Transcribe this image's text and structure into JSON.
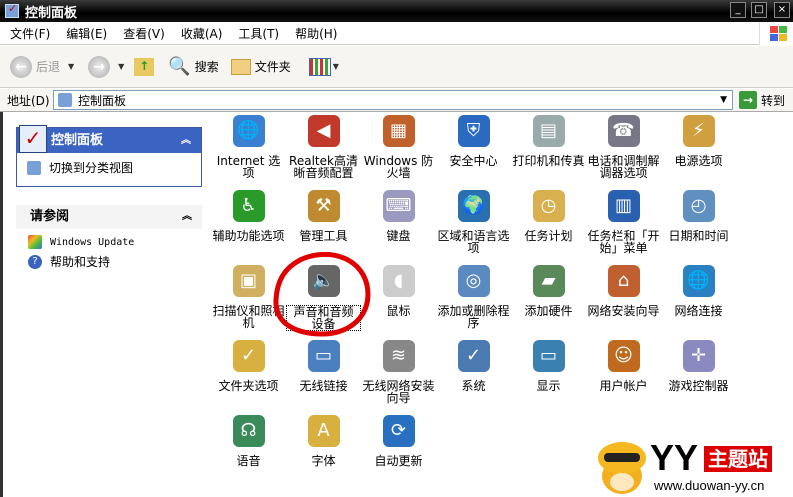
{
  "window": {
    "title": "控制面板",
    "min": "_",
    "max": "□",
    "close": "×"
  },
  "menu": [
    "文件(F)",
    "编辑(E)",
    "查看(V)",
    "收藏(A)",
    "工具(T)",
    "帮助(H)"
  ],
  "toolbar": {
    "back": "后退",
    "search": "搜索",
    "folders": "文件夹"
  },
  "address": {
    "label": "地址(D)",
    "value": "控制面板",
    "go": "转到"
  },
  "left": {
    "panel_title": "控制面板",
    "switch_view": "切换到分类视图",
    "see_also_title": "请参阅",
    "links": [
      "Windows Update",
      "帮助和支持"
    ]
  },
  "items": [
    {
      "label": "Internet 选项",
      "color": "#3a7fd0",
      "glyph": "🌐"
    },
    {
      "label": "Realtek高清晰音频配置",
      "color": "#c0392b",
      "glyph": "◀"
    },
    {
      "label": "Windows 防火墙",
      "color": "#c0602b",
      "glyph": "▦"
    },
    {
      "label": "安全中心",
      "color": "#2a6ac0",
      "glyph": "⛨"
    },
    {
      "label": "打印机和传真",
      "color": "#9aa",
      "glyph": "▤"
    },
    {
      "label": "电话和调制解调器选项",
      "color": "#778",
      "glyph": "☎"
    },
    {
      "label": "电源选项",
      "color": "#d0a040",
      "glyph": "⚡"
    },
    {
      "label": "辅助功能选项",
      "color": "#2a9a2a",
      "glyph": "♿"
    },
    {
      "label": "管理工具",
      "color": "#c08a30",
      "glyph": "⚒"
    },
    {
      "label": "键盘",
      "color": "#9a9ac0",
      "glyph": "⌨"
    },
    {
      "label": "区域和语言选项",
      "color": "#2a70b0",
      "glyph": "🌍"
    },
    {
      "label": "任务计划",
      "color": "#d8b050",
      "glyph": "◷"
    },
    {
      "label": "任务栏和「开始」菜单",
      "color": "#2a60b0",
      "glyph": "▥"
    },
    {
      "label": "日期和时间",
      "color": "#6090c0",
      "glyph": "◴"
    },
    {
      "label": "扫描仪和照相机",
      "color": "#d0b060",
      "glyph": "▣"
    },
    {
      "label": "声音和音频设备",
      "color": "#666",
      "glyph": "🔈",
      "selected": true
    },
    {
      "label": "鼠标",
      "color": "#ccc",
      "glyph": "◖"
    },
    {
      "label": "添加或删除程序",
      "color": "#5a8ac0",
      "glyph": "◎"
    },
    {
      "label": "添加硬件",
      "color": "#5a8a5a",
      "glyph": "▰"
    },
    {
      "label": "网络安装向导",
      "color": "#c06030",
      "glyph": "⌂"
    },
    {
      "label": "网络连接",
      "color": "#2a80c0",
      "glyph": "🌐"
    },
    {
      "label": "文件夹选项",
      "color": "#d8b040",
      "glyph": "✓"
    },
    {
      "label": "无线链接",
      "color": "#4a80c0",
      "glyph": "▭"
    },
    {
      "label": "无线网络安装向导",
      "color": "#888",
      "glyph": "≋"
    },
    {
      "label": "系统",
      "color": "#4a7ab0",
      "glyph": "✓"
    },
    {
      "label": "显示",
      "color": "#3a80b0",
      "glyph": "▭"
    },
    {
      "label": "用户帐户",
      "color": "#c06a20",
      "glyph": "☺"
    },
    {
      "label": "游戏控制器",
      "color": "#8a8ac0",
      "glyph": "✛"
    },
    {
      "label": "语音",
      "color": "#3a8a5a",
      "glyph": "☊"
    },
    {
      "label": "字体",
      "color": "#d8b040",
      "glyph": "A"
    },
    {
      "label": "自动更新",
      "color": "#2a70c0",
      "glyph": "⟳"
    }
  ],
  "watermark": {
    "brand": "YY",
    "name": "主题站",
    "url": "www.duowan-yy.cn"
  },
  "colors": {
    "highlight": "#e00000",
    "panel_header": "#3b64c2"
  }
}
